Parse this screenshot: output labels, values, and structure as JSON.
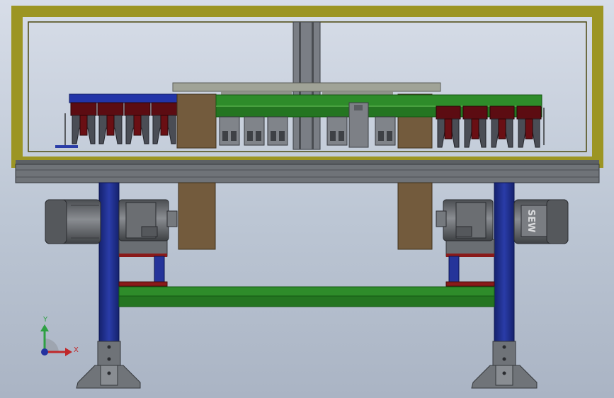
{
  "viewport": {
    "background_top": "#d7dde8",
    "background_bottom": "#aab4c4"
  },
  "triad": {
    "x_label": "X",
    "y_label": "Y",
    "x_color": "#c0282a",
    "y_color": "#2ea043",
    "origin_color": "#2432a0"
  },
  "motor_right": {
    "brand_text": "SEW"
  },
  "colors": {
    "frame_yellow": "#8f8a1e",
    "frame_yellow_light": "#b4ad2a",
    "steel_gray": "#6c7077",
    "leg_blue": "#1f2f8a",
    "conveyor_green": "#2d8a2a",
    "block_brown": "#7a5f3f",
    "part_red": "#6a0f14",
    "base_red": "#8a1a1a",
    "motor_gray": "#5d6064"
  }
}
